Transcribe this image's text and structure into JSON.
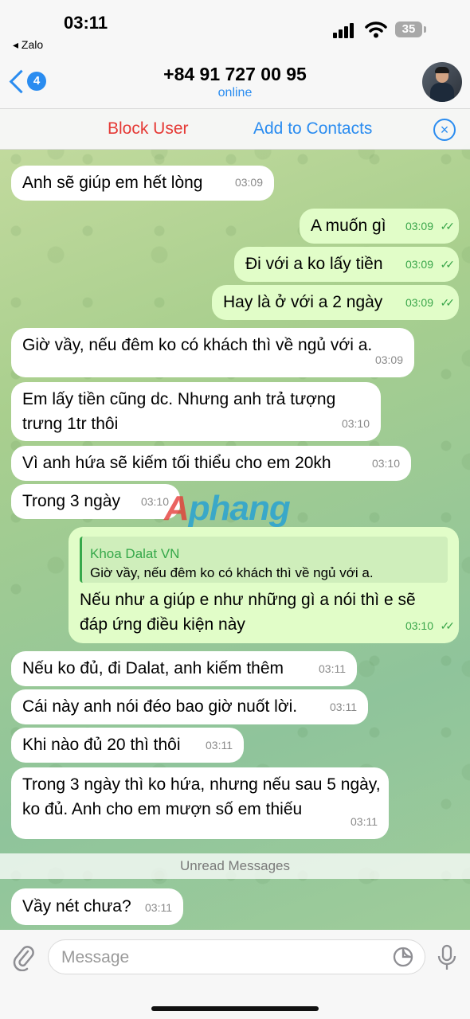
{
  "status": {
    "time": "03:11",
    "back_app": "◂ Zalo",
    "battery": "35"
  },
  "nav": {
    "back_badge": "4",
    "title": "+84 91 727 00 95",
    "subtitle": "online"
  },
  "actions": {
    "block": "Block User",
    "add": "Add to Contacts"
  },
  "messages": [
    {
      "dir": "in",
      "text": "Anh sẽ giúp em hết lòng",
      "time": "03:09"
    },
    {
      "dir": "out",
      "text": "A muốn gì",
      "time": "03:09"
    },
    {
      "dir": "out",
      "text": "Đi với a ko lấy tiền",
      "time": "03:09"
    },
    {
      "dir": "out",
      "text": "Hay là ở với a 2 ngày",
      "time": "03:09"
    },
    {
      "dir": "in",
      "text": "Giờ vầy, nếu đêm ko có khách thì về ngủ với a.",
      "time": "03:09"
    },
    {
      "dir": "in",
      "text": "Em lấy tiền cũng dc. Nhưng anh trả tượng trưng 1tr thôi",
      "time": "03:10"
    },
    {
      "dir": "in",
      "text": "Vì anh hứa sẽ kiếm tối thiểu cho em 20kh",
      "time": "03:10"
    },
    {
      "dir": "in",
      "text": "Trong 3 ngày",
      "time": "03:10"
    },
    {
      "dir": "out",
      "reply_name": "Khoa Dalat VN",
      "reply_text": "Giờ vầy, nếu đêm ko có khách thì về ngủ với a.",
      "text": "Nếu như a giúp e như những gì a nói thì e sẽ đáp ứng điều kiện này",
      "time": "03:10"
    },
    {
      "dir": "in",
      "text": "Nếu ko đủ, đi Dalat, anh kiếm thêm",
      "time": "03:11"
    },
    {
      "dir": "in",
      "text": "Cái này anh nói đéo bao giờ nuốt lời.",
      "time": "03:11"
    },
    {
      "dir": "in",
      "text": "Khi nào đủ 20 thì thôi",
      "time": "03:11"
    },
    {
      "dir": "in",
      "text": "Trong 3 ngày thì ko hứa, nhưng nếu sau 5 ngày, ko đủ. Anh cho em mượn số em thiếu",
      "time": "03:11"
    },
    {
      "dir": "in",
      "text": "Vầy nét chưa?",
      "time": "03:11"
    }
  ],
  "unread_label": "Unread Messages",
  "watermark": {
    "part1": "A",
    "part2": "phang"
  },
  "composer": {
    "placeholder": "Message"
  },
  "colors": {
    "accent": "#2a8cf0",
    "danger": "#e53935",
    "outgoing": "#e1fdc8",
    "read_check": "#3aa64a"
  }
}
